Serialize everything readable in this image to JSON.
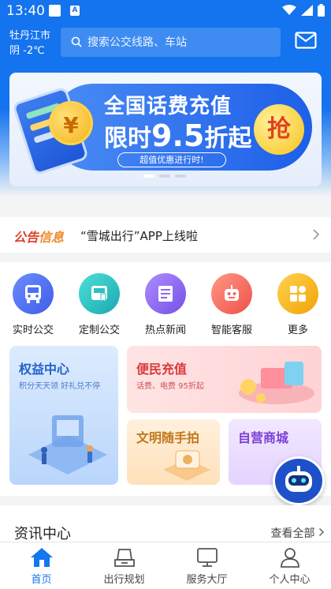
{
  "status_bar": {
    "time": "13:40",
    "notification_icons": [
      "white-square-icon",
      "a-icon"
    ],
    "system_icons": [
      "wifi-icon",
      "signal-icon",
      "battery-icon"
    ]
  },
  "header": {
    "city": "牡丹江市",
    "weather": "阴 -2℃",
    "search_placeholder": "搜索公交线路、车站",
    "colors": {
      "primary": "#1473ee"
    }
  },
  "banner": {
    "title": "全国话费充值",
    "promo": "限时9.5折起",
    "promo_prefix": "限时",
    "promo_number": "9.5",
    "promo_suffix": "折起",
    "subtitle": "超值优惠进行时!",
    "coin_symbol": "¥",
    "grab_label": "抢",
    "page_count": 3,
    "active_page": 1
  },
  "notice": {
    "tag_part1": "公告",
    "tag_part2": "信息",
    "message": "“雪城出行”APP上线啦"
  },
  "quick_actions": [
    {
      "label": "实时公交",
      "icon": "bus-icon",
      "color": "#4e6ff0"
    },
    {
      "label": "定制公交",
      "icon": "custom-bus-icon",
      "color": "#26c2c0"
    },
    {
      "label": "热点新闻",
      "icon": "news-icon",
      "color": "#8f67f0"
    },
    {
      "label": "智能客服",
      "icon": "robot-icon",
      "color": "#f36a5f"
    },
    {
      "label": "更多",
      "icon": "grid-icon",
      "color": "#f7b21b"
    }
  ],
  "feature_cards": {
    "rights": {
      "title": "权益中心",
      "subtitle": "积分天天领 好礼兑不停"
    },
    "recharge": {
      "title": "便民充值",
      "subtitle": "话费、电费 95折起"
    },
    "civil": {
      "title": "文明随手拍"
    },
    "mall": {
      "title": "自营商城"
    }
  },
  "news": {
    "title": "资讯中心",
    "more_label": "查看全部"
  },
  "tab_bar": [
    {
      "label": "首页",
      "icon": "home-icon",
      "active": true
    },
    {
      "label": "出行规划",
      "icon": "route-icon",
      "active": false
    },
    {
      "label": "服务大厅",
      "icon": "monitor-icon",
      "active": false
    },
    {
      "label": "个人中心",
      "icon": "person-icon",
      "active": false
    }
  ]
}
